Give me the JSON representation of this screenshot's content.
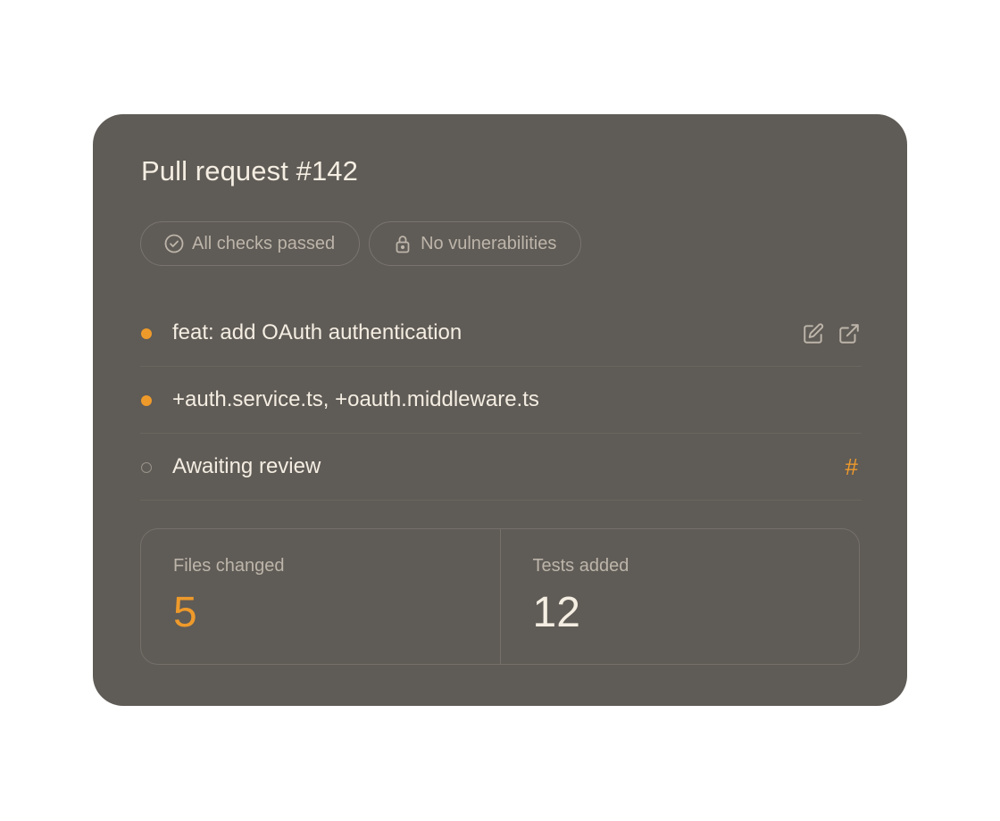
{
  "card": {
    "title": "Pull request #142"
  },
  "badges": [
    {
      "label": "All checks passed",
      "icon": "check-circle-icon"
    },
    {
      "label": "No vulnerabilities",
      "icon": "lock-icon"
    }
  ],
  "rows": [
    {
      "text": "feat: add OAuth authentication",
      "status": "active",
      "actions": [
        "edit-icon",
        "external-link-icon"
      ]
    },
    {
      "text": "+auth.service.ts, +oauth.middleware.ts",
      "status": "active"
    },
    {
      "text": "Awaiting review",
      "status": "pending",
      "action_label": "#"
    }
  ],
  "stats": [
    {
      "label": "Files changed",
      "value": "5"
    },
    {
      "label": "Tests added",
      "value": "12"
    }
  ],
  "colors": {
    "card_bg": "#5f5b56",
    "accent": "#ee9a2b",
    "text_primary": "#f4ede2",
    "text_muted": "#bdb5aa"
  }
}
